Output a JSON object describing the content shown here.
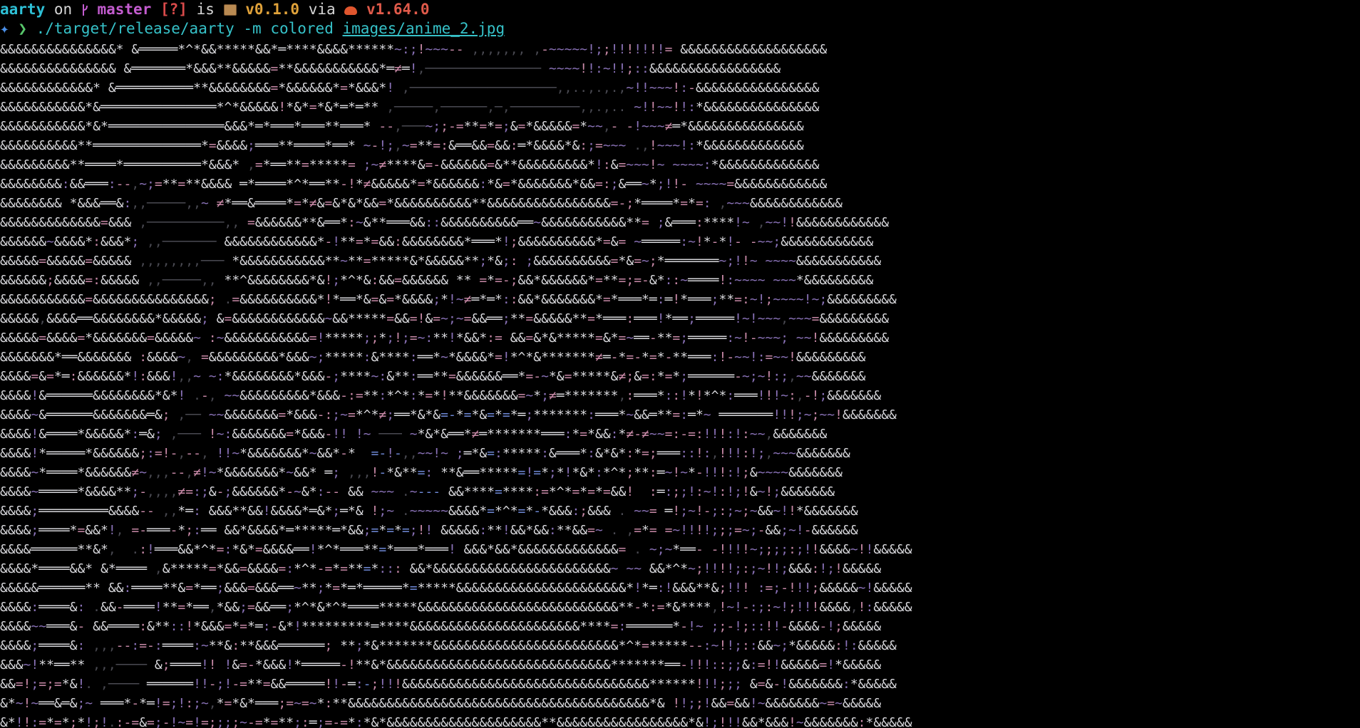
{
  "prompt": {
    "user": "aarty",
    "on": "on",
    "branch_icon": "git-branch-icon",
    "branch": "master",
    "status": "[?]",
    "is": "is",
    "package_icon": "package-icon",
    "version": "v0.1.0",
    "via": "via",
    "rust_icon": "rust-crab-icon",
    "rust_version": "v1.64.0"
  },
  "command": {
    "prompt_symbol_icon": "prompt-diamond-icon",
    "chevron": "❯",
    "text": "./target/release/aarty -m colored",
    "path": "images/anime_2.jpg"
  },
  "colors": {
    "background": "#000000",
    "user": "#2ec0d6",
    "branch": "#c35ccf",
    "status": "#d94a4a",
    "version": "#e0a23a",
    "rust": "#e05a4a",
    "command": "#36c2c9",
    "art_light": "#d8d8dc",
    "art_dim": "#4a4a52",
    "art_purple": "#8a72b8",
    "art_blue": "#6f8ad8",
    "art_pink": "#c98aa8"
  },
  "art_lines": [
    "&&&&&&&&&&&&&&&* &═════*^*&&*****&&*═****&&&&******~:;!~~~-- ,,,,,,, ,-~~~~~!;;!!!!!!!= &&&&&&&&&&&&&&&&&&&",
    "&&&&&&&&&&&&&&& &═══════*&&&**&&&&&=**&&&&&&&&&&&*═≠═!,─────────────── ~~~~!!:~!!;::&&&&&&&&&&&&&&&&&",
    "&&&&&&&&&&&&* &══════════**&&&&&&&&=*&&&&&&*=*&&&*! ,───────────────────,,..,.,.,~!!~~~!:-&&&&&&&&&&&&&&&&",
    "&&&&&&&&&&&*&═══════════════*^*&&&&&!*&*=*&*═*═** ,─────,──────,─,─────────,,.,.. ~!!~~!!:*&&&&&&&&&&&&&&&",
    "&&&&&&&&&&&*&*═══════════════&&&*═*═══*═══**═══* --,───~;;-=**=*=;&=*&&&&&=*~~,- -!~~~≠═*&&&&&&&&&&&&&&&",
    "&&&&&&&&&&**══════════════*=&&&&;═══**════*══* ~-!;,~=**=:&══&&=&&:═*&&&&*&:;=~~~ .,!~~~!:*&&&&&&&&&&&&&",
    "&&&&&&&&&**════*══════════*&&&* ,=*══**=*****= ;~≠****&=-&&&&&&=&**&&&&&&&&&*!:&=~~~!~ ~~~~:*&&&&&&&&&&&&&",
    "&&&&&&&&:&&═══:--,~;=**=**&&&& ═*════*^*══**-!*≠&&&&&*=*&&&&&&:*&=*&&&&&&&*&&=:;&══~*;!!- ~~~~=&&&&&&&&&&&&",
    "&&&&&&&& *&&&══&:,,─────,,~ ≠*══&════*=*≠&=&*&*&&=*&&&&&&&&&&**&&&&&&&&&&&&&&&&=-;*════*=*=: ,~~~&&&&&&&&&&&&",
    "&&&&&&&&&&&&&=&&& ,──────────,, =&&&&&&**&══*:~&**═══&&::&&&&&&&&&&══~&&&&&&&&&&&**= ;&═══:****!~ ,~~!!&&&&&&&&&&&&",
    "&&&&&&~&&&&*:&&&*; ,,─────── &&&&&&&&&&&&*-!**=*=&&:&&&&&&&&*═══*!;&&&&&&&&&&*=&= ~═════:~!*-*!- -~~;&&&&&&&&&&&&",
    "&&&&&=&&&&&=&&&&& ,,,,,,,,─── *&&&&&&&&&&&**~**=*****&*&&&&&**;*&;: ;&&&&&&&&&&=*&=~;*═══════~;!!~ ~~~~&&&&&&&&&&&",
    "&&&&&&;&&&&=:&&&&& ,,─────,, **^&&&&&&&&*&!;*^*&:&&=&&&&&& ** =*=-;&&*&&&&&&*=**=;=-&*::~════!:~~~~ ~~~*&&&&&&&&&",
    "&&&&&&&&&&&=&&&&&&&&&&&&&&&; .=&&&&&&&&&&*!*══*&=&=*&&&&;*!~≠═*═*::&&*&&&&&&&*=*═══*═:═!*═══;**=:~!;~~~~!~;&&&&&&&&&",
    "&&&&&,&&&&══&&&&&&&&*&&&&&; &=&&&&&&&&&&&&~&&*****=&&=!&=~;~=&&══;**=&&&&&**=*═══:═══!*══;═════!~!~~~,~~~=&&&&&&&&&",
    "&&&&&=&&&&=*&&&&&&&=&&&&&~ :~&&&&&&&&&&&=!*****;;*;!;=~:**!*&&*:= &&=&*&*****=&*=~══-**=;═════:~!-~~~; ~~!&&&&&&&&&",
    "&&&&&&&*══&&&&&&& :&&&&~, =&&&&&&&&&*&&&~;*****:&****:══*~*&&&&*=!*^*&*******≠═-*=-*=*-**═══:!-~~!:=~~!&&&&&&&&&",
    "&&&&=&=*═:&&&&&&*!:&&&!,,~ ~:*&&&&&&&&*&&&-;****~:&**:══**=&&&&&&══*=-~*&=*****&≠;&=:*=*;══════-~;~!:;,~~&&&&&&&",
    "&&&&!&══════&&&&&&&&*&*! .-, ~~&&&&&&&&&*&&&-:=**:*^*:*=*!**&&&&&&&=~*;≠═*******,:═══*::!*!*^*:═══!!!~:,-!;&&&&&&&",
    "&&&&~&══════&&&&&&&═&; ,── ~~&&&&&&&=*&&&-:;~=*^*≠;══*&*&=-*=*&=*=*═;*******:═══*~&&═**=:═*~ ═══════!!!;~;~~!&&&&&&&",
    "&&&&!&════*&&&&&*:═&; ,─── !~:&&&&&&&=*&&&-!! !~ ─── ~*&*&══*≠═*******═══:*=*&&:*≠-≠~~=:-=:!!!:!:~~,&&&&&&&",
    "&&&&!*═════*&&&&&&;:=!-,--, !!~*&&&&&&&*~&&*-*  =-!-,,~~!~ ;═*&=:*****:&═══*:&*&*:*=;═══::!:,!!!:!;,~~~&&&&&&&",
    "&&&&~*════*&&&&&&≠~,,,--,≠!~*&&&&&&&*~&&* ═; ,,,!-*&**=: **&══*****=!=*;*!*&*:*^*;**:═~!~*-!!!:!;&~~~~&&&&&&&",
    "&&&&~═════*&&&&**;-,,,,≠=:;&-;&&&&&&*-~&*:-- && ~~~ .~--- &&****=****:=*^*=*=*=&&!  :═:;;!:~!:!;!&~!;&&&&&&&",
    "&&&&;═════════&&&&-- ,,*═: &&&**&&!&&&&*═&*;═*& !;~ .~~~~~&&&&*=*^*=*-*&&&:;&&& . ~~= ═!;~!-;:;~;~&&~!!*&&&&&&&",
    "&&&&;════*=&&*!, =-═══-*;:══ &&*&&&&*═*****═*&&;=*=*=;!! &&&&&:**!&&*&&:**&&=~ . ,=*= =~!!!!;;;=~;-&&;~!-&&&&&&",
    "&&&&══════**&*,  .:!═══&&*^*=:*&*=&&&&══!*^*═══**=*═══*═══! &&&*&&*&&&&&&&&&&&&&= . ~;~*══- -!!!!~;;;;:;!!&&&&~!!&&&&&",
    "&&&&*════&&* &*════ ,&*****=*&&=&&&&=:*^*-=*=**=*::: &&*&&&&&&&&&&&&&&&&&&&&&&&~ ~~ &&*^*~;!!!!;:;~!!;&&&:!;!&&&&&",
    "&&&&&══════** &&:════**&=*══;&&&=&&&══~**;*=*═*═════*=*****&&&&&&&&&&&&&&&&&&&&&&*!*═:!&&&**&;!!! :=;-!!!;&&&&&~!&&&&&",
    "&&&&:════&: .&&-════!**=*══,*&&;=&&══;*^*&*^*════*****&&&&&&&&&&&&&&&&&&&&&&&&&&**-*:=*&****,!~!-:;:~!;!!!&&&&,!:&&&&&",
    "&&&&~~═══&- &&════:&**::!*&&&=*=*═:-&*!*********═****&&&&&&&&&&&&&&&&&&&&&&****=:══════*-!~ ;;-!;::!!-&&&&-!;&&&&&",
    "&&&&;════&: ,,,--:=-:════:~**&:**&&&══════; **;*&*******&&&&&&&&&&&&&&&&&&&&&&&&*^*=*****--:~!!;::&&~;*&&&&&:!:&&&&&",
    "&&&~!**══** ,,,──── &;════!! !&=-*&&&!*═════-!**&*&&&&&&&&&&&&&&&&&&&&&&&&&&&&&*******══-!!!::;;&:=!!&&&&&=!*&&&&&",
    "&&=!;=;=*&!. ,──── ══════!!-;!-=**=&&═════!!-═:-;!!!&&&&&&&&&&&&&&&&&&&&&&&&&&&&&&&&******!!!;;; &=&-!&&&&&&&:*&&&&&",
    "&*~!~══&═&;~ ═══*-*═!=;!:;~,*=*&*═══;=~=~*:**&&&&&&&&&&&&&&&&&&&&&&&&&&&&&&&&&&&&&&&*& !!;;!&&=&&!~&&&&&&&~=~&&&&&",
    "&*!!:=*=*;*!;!.:-=&=;-!~=!=;;;;~-=*=**;:═;=-=*:*&*&&&&&&&&&&&&&&&&&&&&**&&&&&&&&&&&&&&&&&*&!;!!!&&*&&&!~&&&&&&&:*&&&&&"
  ]
}
